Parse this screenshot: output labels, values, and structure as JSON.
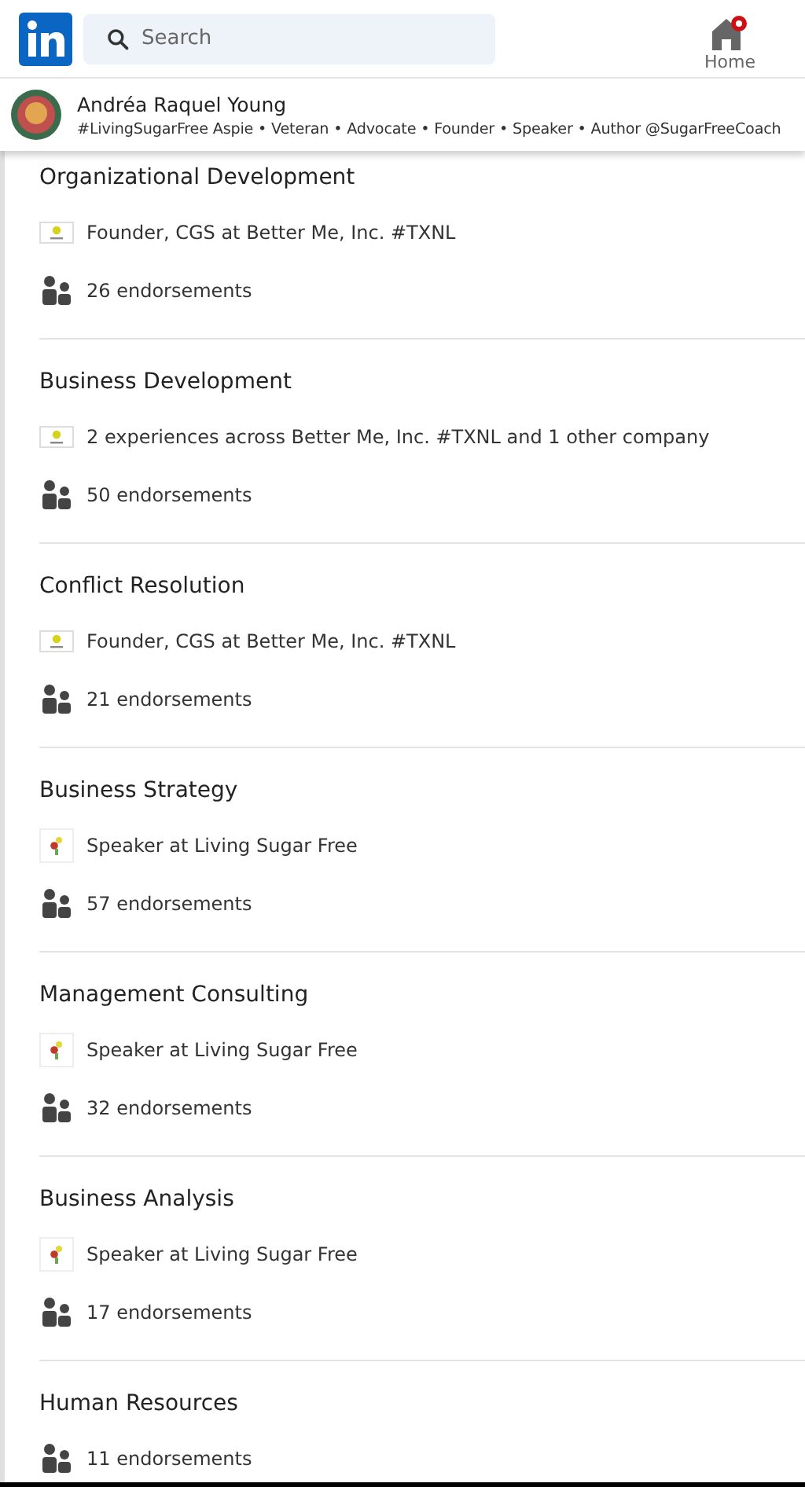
{
  "header": {
    "search": {
      "placeholder": "Search"
    },
    "nav": [
      {
        "label": "Home",
        "notification": true
      }
    ]
  },
  "profile": {
    "name": "Andréa Raquel Young",
    "headline": "#LivingSugarFree Aspie • Veteran • Advocate • Founder • Speaker • Author @SugarFreeCoach"
  },
  "skills": [
    {
      "name": "Organizational Development",
      "experience": {
        "kind": "betterme",
        "text": "Founder, CGS at Better Me, Inc. #TXNL"
      },
      "endorsements": "26 endorsements"
    },
    {
      "name": "Business Development",
      "experience": {
        "kind": "betterme",
        "text": "2 experiences across Better Me, Inc. #TXNL and 1 other company"
      },
      "endorsements": "50 endorsements"
    },
    {
      "name": "Conflict Resolution",
      "experience": {
        "kind": "betterme",
        "text": "Founder, CGS at Better Me, Inc. #TXNL"
      },
      "endorsements": "21 endorsements"
    },
    {
      "name": "Business Strategy",
      "experience": {
        "kind": "livingsugar",
        "text": "Speaker at Living Sugar Free"
      },
      "endorsements": "57 endorsements"
    },
    {
      "name": "Management Consulting",
      "experience": {
        "kind": "livingsugar",
        "text": "Speaker at Living Sugar Free"
      },
      "endorsements": "32 endorsements"
    },
    {
      "name": "Business Analysis",
      "experience": {
        "kind": "livingsugar",
        "text": "Speaker at Living Sugar Free"
      },
      "endorsements": "17 endorsements"
    },
    {
      "name": "Human Resources",
      "endorsements": "11 endorsements"
    }
  ]
}
